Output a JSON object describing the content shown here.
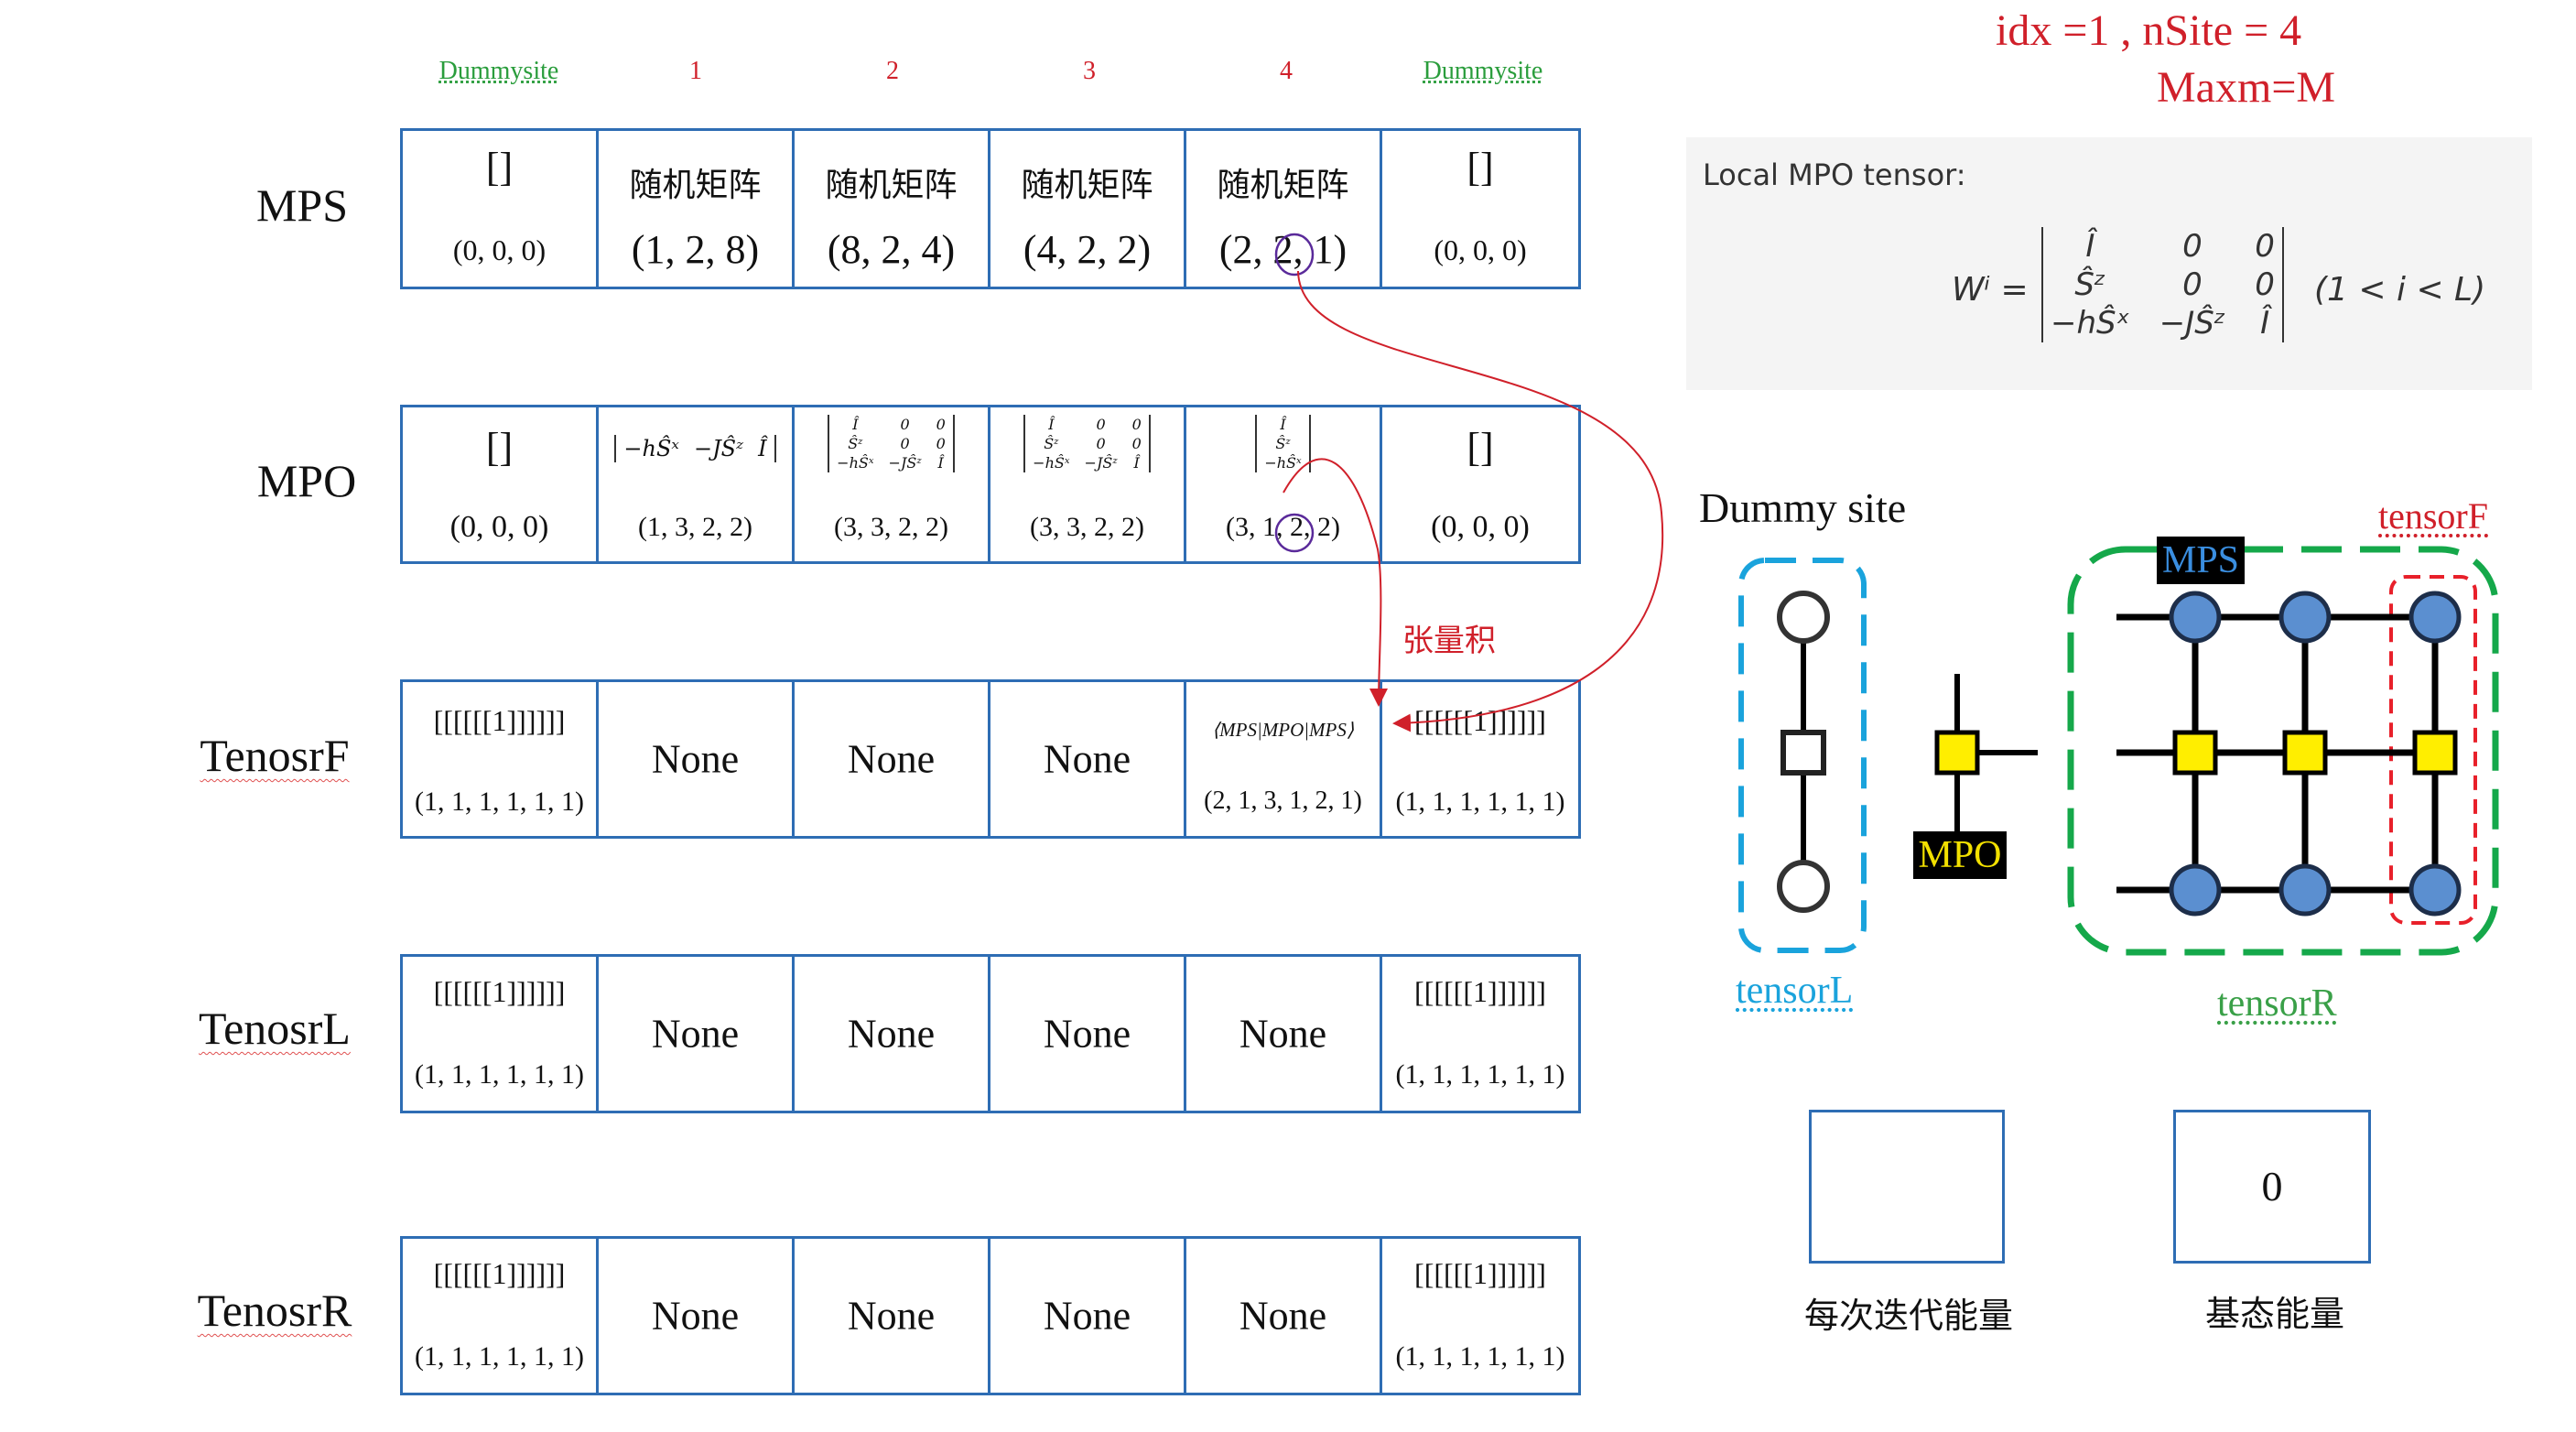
{
  "header": {
    "line1": "idx =1 , nSite = 4",
    "line2": "Maxm=M"
  },
  "columns": [
    "Dummysite",
    "1",
    "2",
    "3",
    "4",
    "Dummysite"
  ],
  "rows": {
    "mps": {
      "label": "MPS",
      "cells": [
        {
          "top": "[]",
          "bottom": "(0, 0, 0)"
        },
        {
          "top": "随机矩阵",
          "bottom": "(1, 2, 8)"
        },
        {
          "top": "随机矩阵",
          "bottom": "(8, 2, 4)"
        },
        {
          "top": "随机矩阵",
          "bottom": "(4, 2, 2)"
        },
        {
          "top": "随机矩阵",
          "bottom": "(2, 2, 1)"
        },
        {
          "top": "[]",
          "bottom": "(0, 0, 0)"
        }
      ]
    },
    "mpo": {
      "label": "MPO",
      "cells": [
        {
          "top": "[]",
          "bottom": "(0, 0, 0)"
        },
        {
          "row": [
            "−hŜˣ",
            "−JŜᶻ",
            "Î"
          ],
          "bottom": "(1, 3, 2, 2)"
        },
        {
          "matrix": [
            [
              "Î",
              "0",
              "0"
            ],
            [
              "Ŝᶻ",
              "0",
              "0"
            ],
            [
              "−hŜˣ",
              "−JŜᶻ",
              "Î"
            ]
          ],
          "bottom": "(3, 3, 2, 2)"
        },
        {
          "matrix": [
            [
              "Î",
              "0",
              "0"
            ],
            [
              "Ŝᶻ",
              "0",
              "0"
            ],
            [
              "−hŜˣ",
              "−JŜᶻ",
              "Î"
            ]
          ],
          "bottom": "(3, 3, 2, 2)"
        },
        {
          "matrix": [
            [
              "Î"
            ],
            [
              "Ŝᶻ"
            ],
            [
              "−hŜˣ"
            ]
          ],
          "bottom": "(3, 1, 2, 2)"
        },
        {
          "top": "[]",
          "bottom": "(0, 0, 0)"
        }
      ]
    },
    "tensorF": {
      "label": "TenosrF",
      "cells": [
        {
          "top": "[[[[[[1]]]]]]",
          "bottom": "(1, 1, 1, 1, 1, 1)"
        },
        {
          "mid": "None"
        },
        {
          "mid": "None"
        },
        {
          "mid": "None"
        },
        {
          "top": "⟨MPS|MPO|MPS⟩",
          "bottom": "(2, 1, 3, 1, 2, 1)"
        },
        {
          "top": "[[[[[[1]]]]]]",
          "bottom": "(1, 1, 1, 1, 1, 1)"
        }
      ]
    },
    "tensorL": {
      "label": "TenosrL",
      "cells": [
        {
          "top": "[[[[[[1]]]]]]",
          "bottom": "(1, 1, 1, 1, 1, 1)"
        },
        {
          "mid": "None"
        },
        {
          "mid": "None"
        },
        {
          "mid": "None"
        },
        {
          "mid": "None"
        },
        {
          "top": "[[[[[[1]]]]]]",
          "bottom": "(1, 1, 1, 1, 1, 1)"
        }
      ]
    },
    "tensorR": {
      "label": "TenosrR",
      "cells": [
        {
          "top": "[[[[[[1]]]]]]",
          "bottom": "(1, 1, 1, 1, 1, 1)"
        },
        {
          "mid": "None"
        },
        {
          "mid": "None"
        },
        {
          "mid": "None"
        },
        {
          "mid": "None"
        },
        {
          "top": "[[[[[[1]]]]]]",
          "bottom": "(1, 1, 1, 1, 1, 1)"
        }
      ]
    }
  },
  "annotation": "张量积",
  "localMpo": {
    "title": "Local MPO tensor:",
    "lhs": "Wⁱ =",
    "matrix": [
      [
        "Î",
        "0",
        "0"
      ],
      [
        "Ŝᶻ",
        "0",
        "0"
      ],
      [
        "−hŜˣ",
        "−JŜᶻ",
        "Î"
      ]
    ],
    "condition": "(1 < i < L)"
  },
  "network": {
    "dummySite": "Dummy site",
    "mpsTag": "MPS",
    "mpoTag": "MPO",
    "tensorF": "tensorF",
    "tensorL": "tensorL",
    "tensorR": "tensorR"
  },
  "energies": {
    "iterLabel": "每次迭代能量",
    "iterValue": "",
    "groundLabel": "基态能量",
    "groundValue": "0"
  },
  "colors": {
    "tableBorder": "#2e6db4",
    "accentRed": "#d0202a",
    "accentGreen": "#2a9d3c",
    "tensorLBox": "#1aa3dc",
    "tensorRBox": "#15a84a",
    "mpsNode": "#5b8fd0",
    "mpoNode": "#ffee00"
  }
}
